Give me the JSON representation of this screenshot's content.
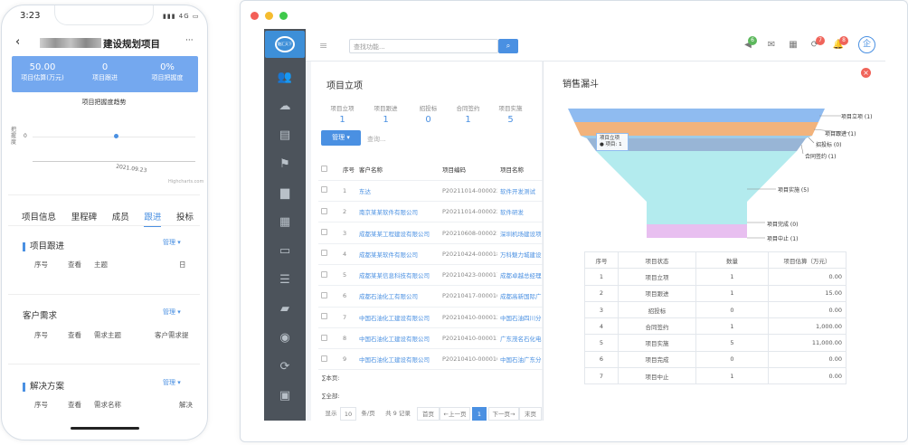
{
  "phone": {
    "time": "3:23",
    "signal": "4G",
    "back": "‹",
    "title": "建设规划项目",
    "more": "···",
    "stats": [
      {
        "value": "50.00",
        "label": "项目估算(万元)"
      },
      {
        "value": "0",
        "label": "项目跟进"
      },
      {
        "value": "0%",
        "label": "项目把握度"
      }
    ],
    "trend_title": "项目把握度趋势",
    "y_label": "把握度",
    "y_tick": "0",
    "x_tick": "2021.09.23",
    "credit": "Highcharts.com",
    "tabs": [
      "项目信息",
      "里程碑",
      "成员",
      "跟进",
      "投标"
    ],
    "active_tab": "跟进",
    "sections": [
      {
        "title": "项目跟进",
        "manage": "管理 ▾",
        "cols": [
          "序号",
          "查看",
          "主题",
          "日"
        ]
      },
      {
        "title": "客户需求",
        "manage": "管理 ▾",
        "cols": [
          "序号",
          "查看",
          "需求主题",
          "客户需求提"
        ]
      },
      {
        "title": "解决方案",
        "manage": "管理 ▾",
        "cols": [
          "序号",
          "查看",
          "需求名称",
          "解决"
        ]
      }
    ]
  },
  "desk": {
    "logo": "融汇天下",
    "search_placeholder": "查找功能...",
    "badges": [
      "6",
      "7",
      "8"
    ],
    "left_title": "项目立项",
    "stats": [
      {
        "label": "项目立项",
        "value": "1"
      },
      {
        "label": "项目跟进",
        "value": "1"
      },
      {
        "label": "招投标",
        "value": "0"
      },
      {
        "label": "合同签约",
        "value": "1"
      },
      {
        "label": "项目实施",
        "value": "5"
      }
    ],
    "manage_btn": "管理 ▾",
    "filter_placeholder": "查询...",
    "table_headers": [
      "序号",
      "客户名称",
      "项目编码",
      "项目名称"
    ],
    "rows": [
      [
        "1",
        "东达",
        "P20211014-000023",
        "软件开发测试"
      ],
      [
        "2",
        "南京某某软件有限公司",
        "P20211014-000022",
        "软件研发"
      ],
      [
        "3",
        "成都某某工程建设有限公司",
        "P20210608-000021",
        "深圳机场建设项"
      ],
      [
        "4",
        "成都某某软件有限公司",
        "P20210424-000018",
        "万科魅力城建设"
      ],
      [
        "5",
        "成都某某信息科技有限公司",
        "P20210423-000017",
        "成都卓越总经理"
      ],
      [
        "6",
        "成都石油化工有限公司",
        "P20210417-000016",
        "成都高新国际广"
      ],
      [
        "7",
        "中国石油化工建设有限公司",
        "P20210410-000012",
        "中国石油四川分"
      ],
      [
        "8",
        "中国石油化工建设有限公司",
        "P20210410-000011",
        "广东茂名石化电"
      ],
      [
        "9",
        "中国石油化工建设有限公司",
        "P20210410-000010",
        "中国石油广东分"
      ]
    ],
    "sum_page": "∑本页:",
    "sum_all": "∑全部:",
    "pager": [
      "显示",
      "10",
      "条/页",
      "共 9 记录",
      "首页",
      "←上一页",
      "1",
      "下一页→",
      "末页"
    ],
    "right_title": "销售漏斗",
    "tooltip_title": "项目立项",
    "tooltip_body": "● 项目: 1",
    "funnel_labels": [
      "项目立项 (1)",
      "项目跟进 (1)",
      "招投标 (0)",
      "合同签约 (1)",
      "项目实施 (5)",
      "项目完成 (0)",
      "项目中止 (1)"
    ],
    "funnel_colors": [
      "#8fbbf0",
      "#f2b37c",
      "#9ecbe8",
      "#98b5d6",
      "#b3ebee",
      "#b3ebee",
      "#e8bff0"
    ],
    "table_r_headers": [
      "序号",
      "项目状态",
      "数量",
      "项目估算（万元）"
    ],
    "table_r_rows": [
      [
        "1",
        "项目立项",
        "1",
        "0.00"
      ],
      [
        "2",
        "项目跟进",
        "1",
        "15.00"
      ],
      [
        "3",
        "招投标",
        "0",
        "0.00"
      ],
      [
        "4",
        "合同签约",
        "1",
        "1,000.00"
      ],
      [
        "5",
        "项目实施",
        "5",
        "11,000.00"
      ],
      [
        "6",
        "项目完成",
        "0",
        "0.00"
      ],
      [
        "7",
        "项目中止",
        "1",
        "0.00"
      ]
    ]
  }
}
